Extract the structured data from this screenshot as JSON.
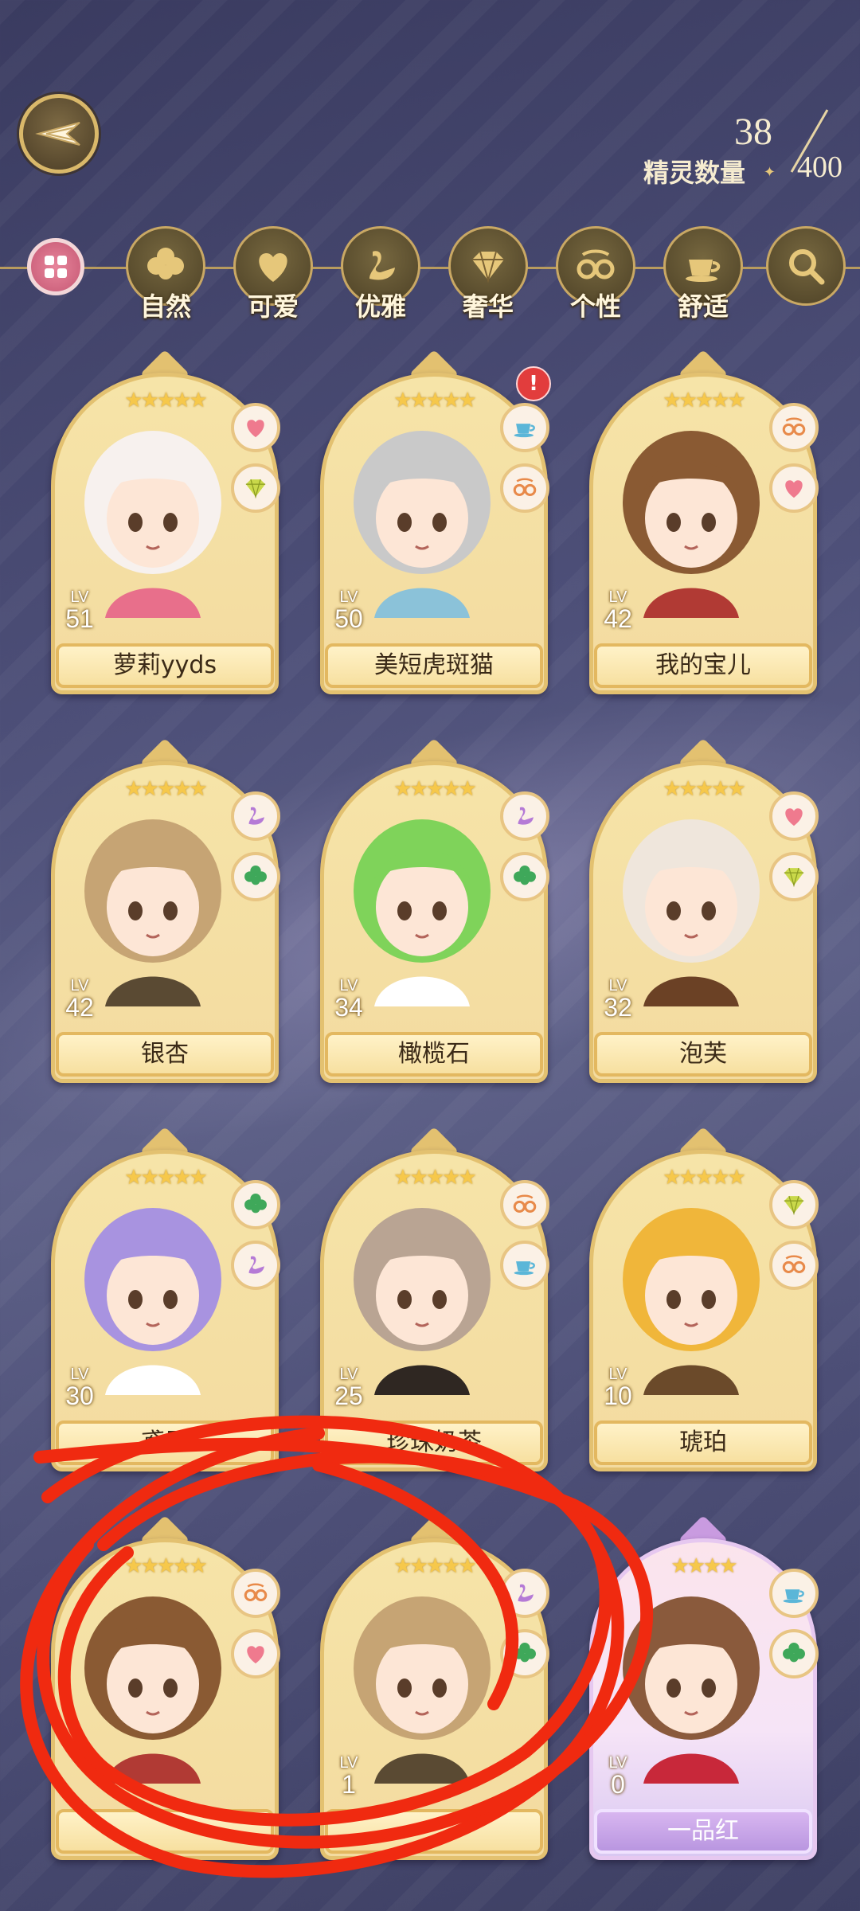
{
  "header": {
    "count_current": "38",
    "count_label": "精灵数量",
    "count_max": "400",
    "back_icon": "back-wing-icon"
  },
  "filters": [
    {
      "label": "",
      "icon": "grid-icon"
    },
    {
      "label": "自然",
      "icon": "clover-icon"
    },
    {
      "label": "可爱",
      "icon": "heart-icon"
    },
    {
      "label": "优雅",
      "icon": "swan-icon"
    },
    {
      "label": "奢华",
      "icon": "diamond-icon"
    },
    {
      "label": "个性",
      "icon": "glasses-icon"
    },
    {
      "label": "舒适",
      "icon": "teacup-icon"
    },
    {
      "label": "",
      "icon": "search-icon"
    }
  ],
  "cards": [
    {
      "name": "萝莉yyds",
      "level": "51",
      "lv_label": "LV",
      "stars": "★★★★★",
      "traits": [
        "heart-icon",
        "diamond-icon"
      ],
      "hair": "#f7f1ee",
      "accent": "#e86f8b"
    },
    {
      "name": "美短虎斑猫",
      "level": "50",
      "lv_label": "LV",
      "stars": "★★★★★",
      "traits": [
        "teacup-icon",
        "glasses-icon"
      ],
      "alert": "!",
      "hair": "#c9c9c9",
      "accent": "#8bc2d9"
    },
    {
      "name": "我的宝儿",
      "level": "42",
      "lv_label": "LV",
      "stars": "★★★★★",
      "traits": [
        "glasses-icon",
        "heart-icon"
      ],
      "hair": "#8a5a33",
      "accent": "#b13a34"
    },
    {
      "name": "银杏",
      "level": "42",
      "lv_label": "LV",
      "stars": "★★★★★",
      "traits": [
        "swan-icon",
        "clover-icon"
      ],
      "hair": "#c6a474",
      "accent": "#5a4a33"
    },
    {
      "name": "橄榄石",
      "level": "34",
      "lv_label": "LV",
      "stars": "★★★★★",
      "traits": [
        "swan-icon",
        "clover-icon"
      ],
      "hair": "#7fd35a",
      "accent": "#ffffff"
    },
    {
      "name": "泡芙",
      "level": "32",
      "lv_label": "LV",
      "stars": "★★★★★",
      "traits": [
        "heart-icon",
        "diamond-icon"
      ],
      "hair": "#efe6dc",
      "accent": "#6b4125"
    },
    {
      "name": "鸢尾",
      "level": "30",
      "lv_label": "LV",
      "stars": "★★★★★",
      "traits": [
        "clover-icon",
        "swan-icon"
      ],
      "hair": "#a893e0",
      "accent": "#ffffff"
    },
    {
      "name": "珍珠奶茶",
      "level": "25",
      "lv_label": "LV",
      "stars": "★★★★★",
      "traits": [
        "glasses-icon",
        "teacup-icon"
      ],
      "hair": "#b9a493",
      "accent": "#2f2722"
    },
    {
      "name": "琥珀",
      "level": "10",
      "lv_label": "LV",
      "stars": "★★★★★",
      "traits": [
        "diamond-icon",
        "glasses-icon"
      ],
      "hair": "#f0b63a",
      "accent": "#6b4a2a"
    },
    {
      "name": "",
      "level": "",
      "lv_label": "",
      "stars": "★★★★★",
      "traits": [
        "glasses-icon",
        "heart-icon"
      ],
      "hair": "#8a5a33",
      "accent": "#b13a34"
    },
    {
      "name": "",
      "level": "1",
      "lv_label": "LV",
      "stars": "★★★★★",
      "traits": [
        "swan-icon",
        "clover-icon"
      ],
      "hair": "#c6a474",
      "accent": "#5a4a33"
    },
    {
      "name": "一品红",
      "level": "0",
      "lv_label": "LV",
      "stars": "★★★★",
      "traits": [
        "teacup-icon",
        "clover-icon"
      ],
      "hair": "#8a5a3c",
      "accent": "#c8283a",
      "special": true
    }
  ],
  "colors": {
    "background": "#4d4f78",
    "card_gold": "#e3c170",
    "scribble_red": "#f02a10"
  }
}
